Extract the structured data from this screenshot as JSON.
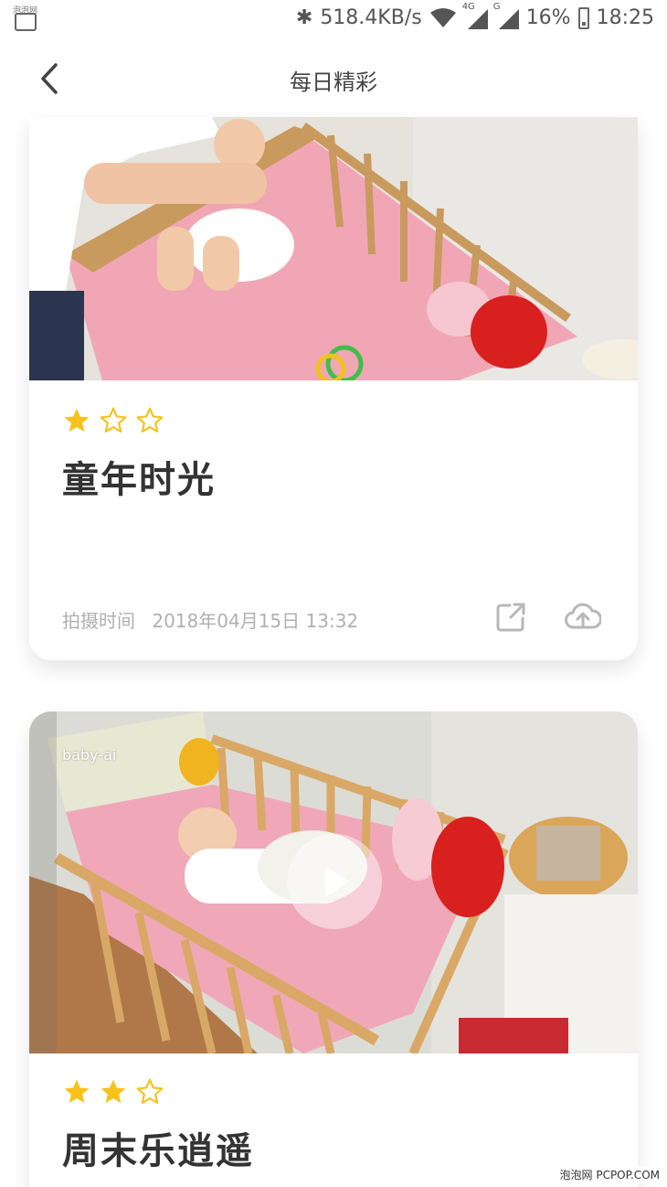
{
  "status_bar": {
    "corner_text": "泡泡网",
    "network_speed": "518.4KB/s",
    "signal1_label": "4G",
    "signal2_label": "G",
    "battery_percent": "16%",
    "time": "18:25"
  },
  "header": {
    "title": "每日精彩",
    "back_icon": "back-arrow-icon"
  },
  "cards": [
    {
      "rating": 1,
      "max_rating": 3,
      "title": "童年时光",
      "time_label": "拍摄时间",
      "time_value": "2018年04月15日 13:32",
      "has_video": false
    },
    {
      "rating": 2,
      "max_rating": 3,
      "title": "周末乐逍遥",
      "watermark": "baby-ai",
      "has_video": true
    }
  ],
  "colors": {
    "star_filled": "#f6c21b",
    "star_empty": "#f6c21b",
    "meta_text": "#b0b0b0",
    "title_text": "#333333"
  },
  "footer_watermark": "泡泡网 PCPOP.COM"
}
